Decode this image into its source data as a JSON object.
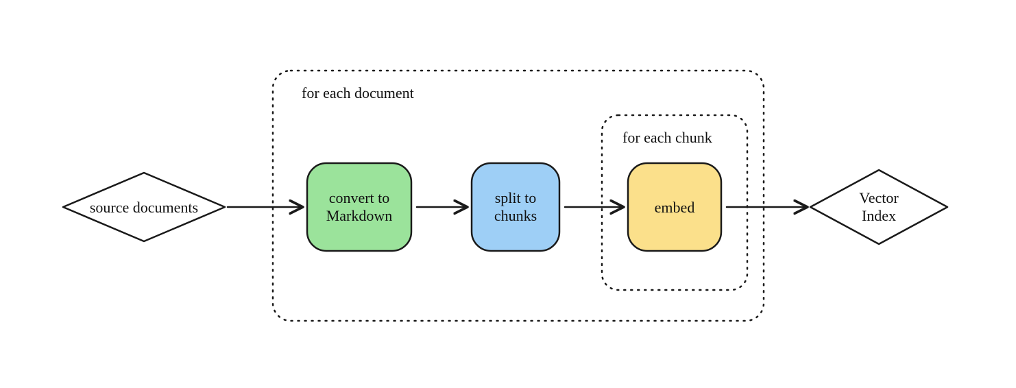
{
  "nodes": {
    "source": {
      "label": "source documents"
    },
    "convert": {
      "line1": "convert to",
      "line2": "Markdown"
    },
    "split": {
      "line1": "split to",
      "line2": "chunks"
    },
    "embed": {
      "label": "embed"
    },
    "vector": {
      "line1": "Vector",
      "line2": "Index"
    }
  },
  "groups": {
    "outer": {
      "label": "for each document"
    },
    "inner": {
      "label": "for each chunk"
    }
  },
  "colors": {
    "convert": "#9be39b",
    "split": "#9ecff6",
    "embed": "#fbe08b",
    "stroke": "#1a1a1a"
  }
}
